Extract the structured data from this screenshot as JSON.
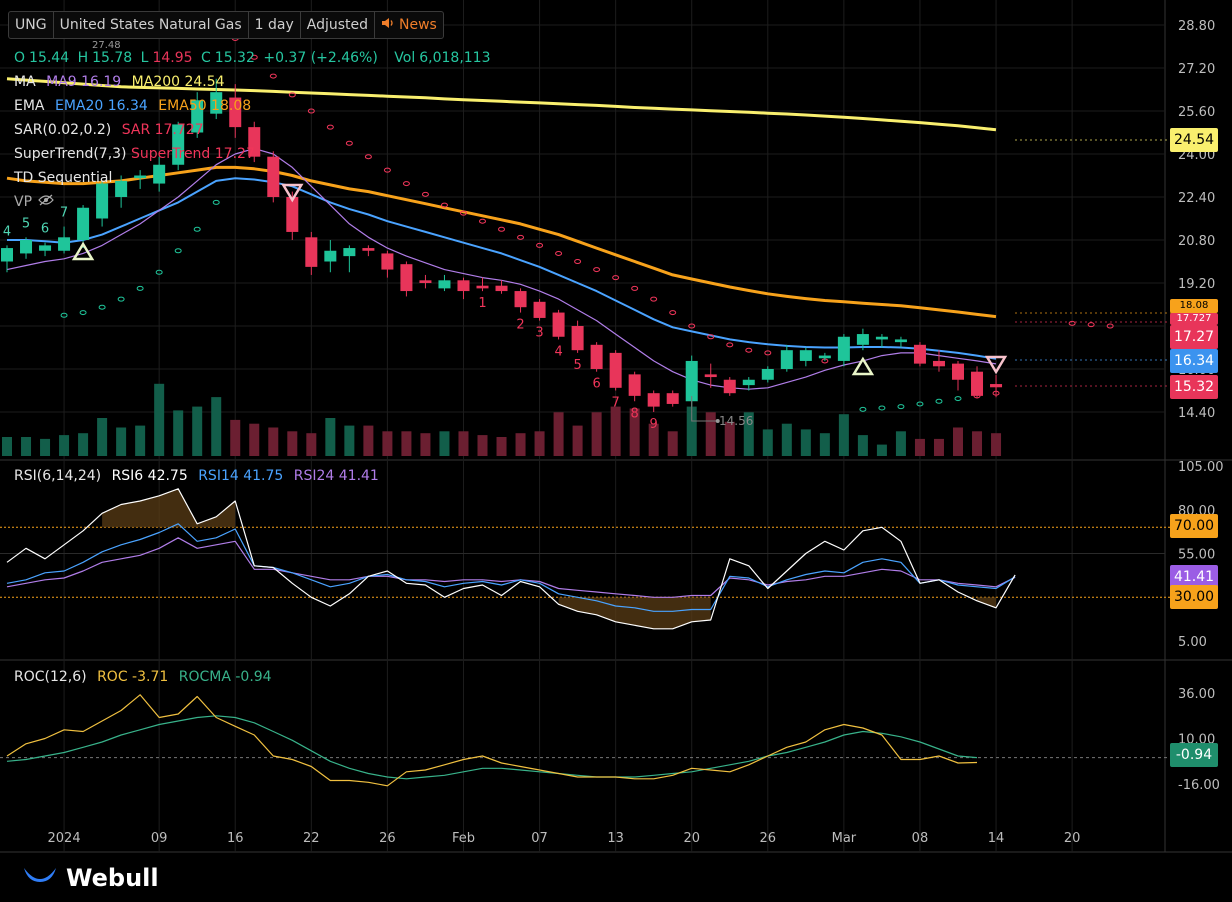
{
  "header": {
    "symbol": "UNG",
    "name": "United States Natural Gas",
    "interval": "1 day",
    "adjustment": "Adjusted",
    "news_label": "News"
  },
  "ohlc": {
    "o_label": "O",
    "o": "15.44",
    "h_label": "H",
    "h": "15.78",
    "l_label": "L",
    "l": "14.95",
    "c_label": "C",
    "c": "15.32",
    "change": "+0.37 (+2.46%)",
    "vol_label": "Vol",
    "vol": "6,018,113",
    "hidden_peak": "27.48"
  },
  "indicators": {
    "ma": {
      "label": "MA",
      "ma9": "MA9 16.19",
      "ma200": "MA200 24.54"
    },
    "ema": {
      "label": "EMA",
      "ema20": "EMA20 16.34",
      "ema50": "EMA50 18.08"
    },
    "sar": {
      "label": "SAR(0.02,0.2)",
      "value": "SAR 17.727"
    },
    "supertrend": {
      "label": "SuperTrend(7,3)",
      "value": "SuperTrend 17.27"
    },
    "td": {
      "label": "TD Sequential"
    },
    "vp": {
      "label": "VP"
    },
    "rsi": {
      "label": "RSI(6,14,24)",
      "rsi6": "RSI6 42.75",
      "rsi14": "RSI14 41.75",
      "rsi24": "RSI24 41.41"
    },
    "roc": {
      "label": "ROC(12,6)",
      "roc": "ROC -3.71",
      "rocma": "ROCMA -0.94"
    }
  },
  "badges": {
    "ma200": "24.54",
    "ema50": "18.08",
    "sar": "17.727",
    "supertrend": "17.27",
    "ema20": "16.34",
    "close": "15.32",
    "rsi_overbought": "70.00",
    "rsi24": "41.41",
    "rsi_oversold": "30.00",
    "rocma": "-0.94"
  },
  "low_marker": "14.56",
  "branding": {
    "logo_text": "Webull"
  },
  "colors": {
    "up": "#1fc59a",
    "down": "#e8355a",
    "ma9": "#b07de8",
    "ma200": "#f9ef6e",
    "ema20": "#4aa3ff",
    "ema50": "#f7a21b",
    "sar": "#f0355a",
    "rsi6": "#ffffff",
    "rsi14": "#4aa3ff",
    "rsi24": "#b07de8",
    "roc": "#f0c040",
    "rocma": "#38b28a",
    "rsi_band": "#f7a21b",
    "td_label_up": "#4fd5b3",
    "td_label_down": "#f0355a"
  },
  "chart_data": {
    "type": "candlestick",
    "price_axis": {
      "ticks": [
        "28.80",
        "27.20",
        "25.60",
        "24.00",
        "22.40",
        "20.80",
        "19.20",
        "17.60",
        "16.00",
        "14.40"
      ],
      "ylim": [
        13.2,
        29.5
      ]
    },
    "x_ticks": [
      "2024",
      "09",
      "16",
      "22",
      "26",
      "Feb",
      "07",
      "13",
      "20",
      "26",
      "Mar",
      "08",
      "14",
      "20"
    ],
    "candles": [
      {
        "o": 20.0,
        "h": 20.6,
        "l": 19.6,
        "c": 20.5,
        "v": 1.0,
        "td": "4"
      },
      {
        "o": 20.3,
        "h": 20.9,
        "l": 20.1,
        "c": 20.8,
        "v": 1.0,
        "td": "5"
      },
      {
        "o": 20.4,
        "h": 20.7,
        "l": 20.2,
        "c": 20.6,
        "v": 0.9,
        "td": "6"
      },
      {
        "o": 20.4,
        "h": 21.3,
        "l": 20.3,
        "c": 20.9,
        "v": 1.1,
        "td": "7"
      },
      {
        "o": 20.8,
        "h": 22.1,
        "l": 20.5,
        "c": 22.0,
        "v": 1.2
      },
      {
        "o": 21.6,
        "h": 23.0,
        "l": 21.3,
        "c": 22.9,
        "v": 2.0
      },
      {
        "o": 22.4,
        "h": 23.2,
        "l": 22.0,
        "c": 23.0,
        "v": 1.5
      },
      {
        "o": 23.1,
        "h": 23.4,
        "l": 22.7,
        "c": 23.2,
        "v": 1.6
      },
      {
        "o": 22.9,
        "h": 23.9,
        "l": 22.6,
        "c": 23.6,
        "v": 3.8
      },
      {
        "o": 23.6,
        "h": 25.2,
        "l": 23.4,
        "c": 25.1,
        "v": 2.4
      },
      {
        "o": 24.8,
        "h": 26.3,
        "l": 24.6,
        "c": 26.0,
        "v": 2.6
      },
      {
        "o": 25.5,
        "h": 26.8,
        "l": 25.3,
        "c": 26.3,
        "v": 3.1
      },
      {
        "o": 26.1,
        "h": 26.6,
        "l": 24.6,
        "c": 25.0,
        "v": 1.9
      },
      {
        "o": 25.0,
        "h": 25.2,
        "l": 23.7,
        "c": 23.9,
        "v": 1.7
      },
      {
        "o": 23.9,
        "h": 24.1,
        "l": 22.2,
        "c": 22.4,
        "v": 1.5
      },
      {
        "o": 22.4,
        "h": 22.6,
        "l": 20.8,
        "c": 21.1,
        "v": 1.3
      },
      {
        "o": 20.9,
        "h": 21.1,
        "l": 19.5,
        "c": 19.8,
        "v": 1.2
      },
      {
        "o": 20.0,
        "h": 20.8,
        "l": 19.6,
        "c": 20.4,
        "v": 2.0
      },
      {
        "o": 20.2,
        "h": 20.6,
        "l": 19.6,
        "c": 20.5,
        "v": 1.6
      },
      {
        "o": 20.5,
        "h": 20.6,
        "l": 20.2,
        "c": 20.4,
        "v": 1.6
      },
      {
        "o": 20.3,
        "h": 20.4,
        "l": 19.4,
        "c": 19.7,
        "v": 1.3
      },
      {
        "o": 19.9,
        "h": 20.0,
        "l": 18.7,
        "c": 18.9,
        "v": 1.3
      },
      {
        "o": 19.3,
        "h": 19.5,
        "l": 19.0,
        "c": 19.2,
        "v": 1.2
      },
      {
        "o": 19.0,
        "h": 19.5,
        "l": 18.9,
        "c": 19.3,
        "v": 1.3
      },
      {
        "o": 19.3,
        "h": 19.4,
        "l": 18.6,
        "c": 18.9,
        "v": 1.3
      },
      {
        "o": 19.1,
        "h": 19.4,
        "l": 18.9,
        "c": 19.0,
        "v": 1.1,
        "td": "1"
      },
      {
        "o": 19.1,
        "h": 19.3,
        "l": 18.8,
        "c": 18.9,
        "v": 1.0
      },
      {
        "o": 18.9,
        "h": 19.0,
        "l": 18.1,
        "c": 18.3,
        "v": 1.2,
        "td": "2"
      },
      {
        "o": 18.5,
        "h": 18.6,
        "l": 17.8,
        "c": 17.9,
        "v": 1.3,
        "td": "3"
      },
      {
        "o": 18.1,
        "h": 18.2,
        "l": 17.1,
        "c": 17.2,
        "v": 2.3,
        "td": "4"
      },
      {
        "o": 17.6,
        "h": 17.8,
        "l": 16.6,
        "c": 16.7,
        "v": 1.6,
        "td": "5"
      },
      {
        "o": 16.9,
        "h": 17.0,
        "l": 15.9,
        "c": 16.0,
        "v": 2.3,
        "td": "6"
      },
      {
        "o": 16.6,
        "h": 16.7,
        "l": 15.2,
        "c": 15.3,
        "v": 2.6,
        "td": "7"
      },
      {
        "o": 15.8,
        "h": 15.9,
        "l": 14.8,
        "c": 15.0,
        "v": 2.5,
        "td": "8"
      },
      {
        "o": 15.1,
        "h": 15.2,
        "l": 14.4,
        "c": 14.6,
        "v": 1.7,
        "td": "9"
      },
      {
        "o": 15.1,
        "h": 15.2,
        "l": 14.6,
        "c": 14.7,
        "v": 1.3
      },
      {
        "o": 14.8,
        "h": 16.5,
        "l": 14.6,
        "c": 16.3,
        "v": 2.6
      },
      {
        "o": 15.8,
        "h": 16.2,
        "l": 15.3,
        "c": 15.7,
        "v": 2.3
      },
      {
        "o": 15.6,
        "h": 15.7,
        "l": 15.0,
        "c": 15.1,
        "v": 1.8
      },
      {
        "o": 15.4,
        "h": 15.7,
        "l": 15.2,
        "c": 15.6,
        "v": 2.3
      },
      {
        "o": 15.6,
        "h": 16.1,
        "l": 15.5,
        "c": 16.0,
        "v": 1.4
      },
      {
        "o": 16.0,
        "h": 16.9,
        "l": 15.9,
        "c": 16.7,
        "v": 1.7
      },
      {
        "o": 16.3,
        "h": 16.8,
        "l": 16.1,
        "c": 16.7,
        "v": 1.4
      },
      {
        "o": 16.4,
        "h": 16.6,
        "l": 16.3,
        "c": 16.5,
        "v": 1.2
      },
      {
        "o": 16.3,
        "h": 17.3,
        "l": 16.1,
        "c": 17.2,
        "v": 2.2
      },
      {
        "o": 16.9,
        "h": 17.5,
        "l": 16.7,
        "c": 17.3,
        "v": 1.1
      },
      {
        "o": 17.1,
        "h": 17.3,
        "l": 16.8,
        "c": 17.2,
        "v": 0.6
      },
      {
        "o": 17.0,
        "h": 17.2,
        "l": 16.8,
        "c": 17.1,
        "v": 1.3
      },
      {
        "o": 16.9,
        "h": 17.0,
        "l": 16.1,
        "c": 16.2,
        "v": 0.9
      },
      {
        "o": 16.3,
        "h": 16.7,
        "l": 15.9,
        "c": 16.1,
        "v": 0.9
      },
      {
        "o": 16.2,
        "h": 16.3,
        "l": 15.2,
        "c": 15.6,
        "v": 1.5
      },
      {
        "o": 15.9,
        "h": 16.1,
        "l": 14.9,
        "c": 15.0,
        "v": 1.3
      },
      {
        "o": 15.44,
        "h": 15.78,
        "l": 14.95,
        "c": 15.32,
        "v": 1.2
      }
    ],
    "lines": {
      "ma200": [
        26.8,
        26.75,
        26.7,
        26.65,
        26.6,
        26.55,
        26.5,
        26.48,
        26.46,
        26.44,
        26.42,
        26.4,
        26.38,
        26.36,
        26.33,
        26.3,
        26.27,
        26.24,
        26.21,
        26.18,
        26.15,
        26.12,
        26.09,
        26.05,
        26.02,
        25.99,
        25.96,
        25.93,
        25.9,
        25.87,
        25.84,
        25.81,
        25.77,
        25.73,
        25.7,
        25.67,
        25.64,
        25.61,
        25.58,
        25.55,
        25.52,
        25.49,
        25.45,
        25.41,
        25.37,
        25.32,
        25.27,
        25.22,
        25.17,
        25.11,
        25.05,
        24.98,
        24.9
      ],
      "ema50": [
        23.1,
        23.0,
        22.95,
        22.9,
        22.9,
        22.95,
        23.0,
        23.1,
        23.2,
        23.3,
        23.4,
        23.5,
        23.5,
        23.45,
        23.35,
        23.2,
        23.0,
        22.85,
        22.7,
        22.6,
        22.45,
        22.3,
        22.15,
        22.0,
        21.85,
        21.7,
        21.55,
        21.4,
        21.2,
        21.0,
        20.75,
        20.5,
        20.25,
        20.0,
        19.75,
        19.5,
        19.35,
        19.2,
        19.05,
        18.92,
        18.8,
        18.7,
        18.62,
        18.55,
        18.5,
        18.45,
        18.4,
        18.35,
        18.28,
        18.2,
        18.12,
        18.03,
        17.95
      ],
      "ema20": [
        20.8,
        20.8,
        20.75,
        20.7,
        20.8,
        21.0,
        21.3,
        21.6,
        21.9,
        22.2,
        22.6,
        23.0,
        23.1,
        23.05,
        22.95,
        22.8,
        22.5,
        22.2,
        21.95,
        21.75,
        21.5,
        21.3,
        21.1,
        20.9,
        20.7,
        20.5,
        20.3,
        20.05,
        19.8,
        19.5,
        19.2,
        18.9,
        18.55,
        18.2,
        17.85,
        17.55,
        17.4,
        17.25,
        17.1,
        17.0,
        16.92,
        16.86,
        16.82,
        16.8,
        16.8,
        16.82,
        16.82,
        16.8,
        16.75,
        16.68,
        16.6,
        16.5,
        16.38
      ],
      "ma9": [
        19.7,
        19.85,
        20.0,
        20.1,
        20.3,
        20.6,
        21.0,
        21.4,
        21.9,
        22.4,
        23.0,
        23.6,
        24.0,
        24.2,
        24.0,
        23.5,
        22.8,
        22.1,
        21.4,
        20.9,
        20.5,
        20.2,
        19.95,
        19.7,
        19.55,
        19.4,
        19.3,
        19.15,
        18.9,
        18.6,
        18.2,
        17.8,
        17.3,
        16.8,
        16.3,
        15.9,
        15.6,
        15.4,
        15.3,
        15.25,
        15.3,
        15.5,
        15.7,
        15.95,
        16.15,
        16.3,
        16.5,
        16.6,
        16.6,
        16.5,
        16.4,
        16.3,
        16.19
      ],
      "sar": [
        null,
        null,
        null,
        18.0,
        18.1,
        18.3,
        18.6,
        19.0,
        19.6,
        20.4,
        21.2,
        22.2,
        28.3,
        27.6,
        26.9,
        26.2,
        25.6,
        25.0,
        24.4,
        23.9,
        23.4,
        22.9,
        22.5,
        22.1,
        21.8,
        21.5,
        21.2,
        20.9,
        20.6,
        20.3,
        20.0,
        19.7,
        19.4,
        19.0,
        18.6,
        18.1,
        17.6,
        17.2,
        16.9,
        16.7,
        16.6,
        16.5,
        16.4,
        16.3,
        null,
        14.5,
        14.55,
        14.6,
        14.7,
        14.8,
        14.9,
        15.0,
        15.1,
        null,
        null,
        null,
        17.7,
        17.65,
        17.6
      ]
    },
    "rsi": {
      "ticks": [
        "105.00",
        "80.00",
        "55.00",
        "5.00"
      ],
      "ylim": [
        0,
        105
      ],
      "overbought": 70,
      "oversold": 30,
      "rsi6": [
        50,
        58,
        52,
        60,
        68,
        78,
        83,
        85,
        88,
        92,
        72,
        76,
        85,
        48,
        47,
        38,
        30,
        25,
        32,
        42,
        45,
        38,
        37,
        30,
        35,
        37,
        31,
        39,
        36,
        26,
        22,
        20,
        16,
        14,
        12,
        12,
        16,
        17,
        52,
        48,
        35,
        45,
        55,
        62,
        57,
        68,
        70,
        62,
        38,
        40,
        33,
        28,
        24,
        42.75
      ],
      "rsi14": [
        38,
        40,
        44,
        45,
        50,
        56,
        60,
        63,
        67,
        72,
        62,
        64,
        69,
        48,
        47,
        44,
        40,
        36,
        38,
        42,
        43,
        40,
        39,
        36,
        38,
        39,
        37,
        40,
        38,
        32,
        30,
        28,
        25,
        24,
        22,
        22,
        23,
        23,
        42,
        41,
        36,
        40,
        43,
        45,
        44,
        50,
        52,
        50,
        38,
        40,
        37,
        36,
        35,
        41.75
      ],
      "rsi24": [
        36,
        38,
        40,
        41,
        45,
        50,
        52,
        54,
        58,
        64,
        58,
        60,
        62,
        46,
        46,
        44,
        42,
        40,
        40,
        42,
        42,
        40,
        40,
        39,
        40,
        40,
        39,
        40,
        39,
        35,
        34,
        33,
        32,
        31,
        30,
        30,
        31,
        31,
        41,
        40,
        37,
        39,
        40,
        42,
        42,
        44,
        46,
        45,
        40,
        40,
        38,
        37,
        36,
        41.41
      ]
    },
    "roc": {
      "ticks": [
        "36.00",
        "10.00",
        "-16.00"
      ],
      "roc": [
        0,
        7,
        10,
        15,
        14,
        20,
        26,
        35,
        22,
        24,
        34,
        22,
        17,
        12,
        0,
        -2,
        -6,
        -14,
        -14,
        -15,
        -17,
        -9,
        -8,
        -5,
        -2,
        0,
        -4,
        -6,
        -8,
        -10,
        -12,
        -12,
        -12,
        -13,
        -13,
        -11,
        -7,
        -8,
        -9,
        -5,
        0,
        5,
        8,
        15,
        18,
        16,
        12,
        -2,
        -2,
        0,
        -4,
        -3.71,
        null
      ],
      "rocma": [
        -3,
        -2,
        0,
        2,
        5,
        8,
        12,
        15,
        18,
        20,
        22,
        23,
        22,
        19,
        14,
        9,
        3,
        -3,
        -7,
        -10,
        -12,
        -13,
        -12,
        -11,
        -9,
        -7,
        -7,
        -8,
        -9,
        -10,
        -11,
        -12,
        -12,
        -12,
        -11,
        -10,
        -9,
        -7,
        -5,
        -3,
        0,
        2,
        5,
        8,
        12,
        14,
        13,
        11,
        8,
        4,
        0,
        -0.94,
        null
      ]
    }
  }
}
